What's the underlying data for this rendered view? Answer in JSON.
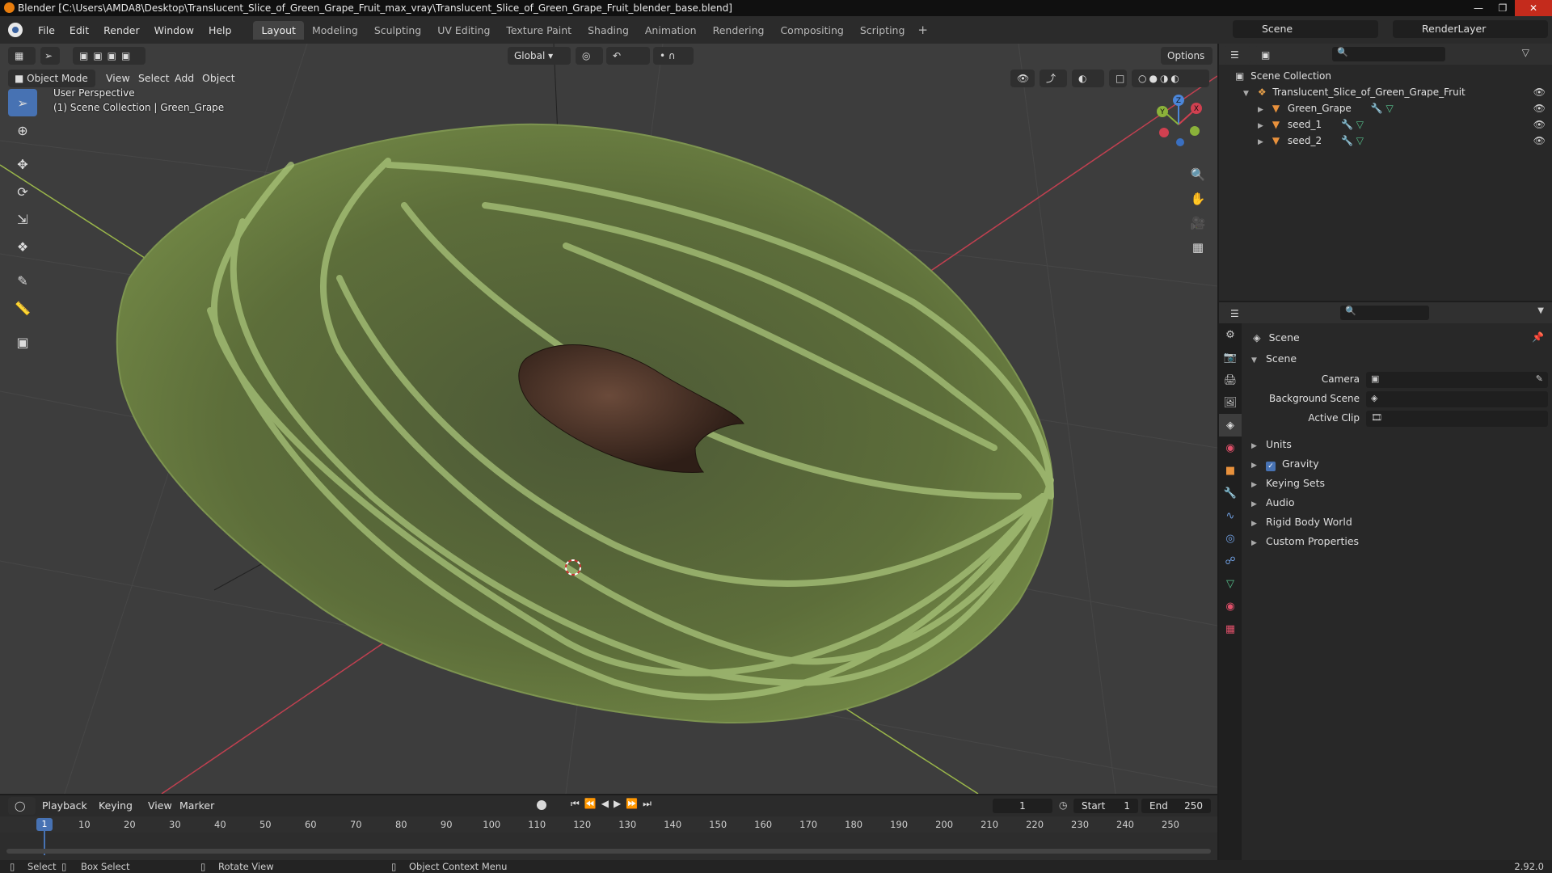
{
  "window": {
    "title": "Blender [C:\\Users\\AMDA8\\Desktop\\Translucent_Slice_of_Green_Grape_Fruit_max_vray\\Translucent_Slice_of_Green_Grape_Fruit_blender_base.blend]"
  },
  "menu": {
    "items": [
      "File",
      "Edit",
      "Render",
      "Window",
      "Help"
    ],
    "workspaces": [
      "Layout",
      "Modeling",
      "Sculpting",
      "UV Editing",
      "Texture Paint",
      "Shading",
      "Animation",
      "Rendering",
      "Compositing",
      "Scripting"
    ],
    "active_workspace": "Layout",
    "scene": "Scene",
    "render_layer": "RenderLayer"
  },
  "viewport": {
    "mode": "Object Mode",
    "menus": [
      "View",
      "Select",
      "Add",
      "Object"
    ],
    "orientation": "Global",
    "options": "Options",
    "perspective": "User Perspective",
    "collection_info": "(1) Scene Collection | Green_Grape"
  },
  "outliner": {
    "root": "Scene Collection",
    "collection": "Translucent_Slice_of_Green_Grape_Fruit",
    "objects": [
      "Green_Grape",
      "seed_1",
      "seed_2"
    ]
  },
  "properties": {
    "context": "Scene",
    "panel": "Scene",
    "fields": {
      "camera": "Camera",
      "background_scene": "Background Scene",
      "active_clip": "Active Clip"
    },
    "subpanels": [
      "Units",
      "Gravity",
      "Keying Sets",
      "Audio",
      "Rigid Body World",
      "Custom Properties"
    ],
    "gravity_enabled": true
  },
  "timeline": {
    "menus": [
      "Playback",
      "Keying",
      "View",
      "Marker"
    ],
    "current_frame": "1",
    "start_label": "Start",
    "start": "1",
    "end_label": "End",
    "end": "250",
    "ruler": [
      "1",
      "10",
      "20",
      "30",
      "40",
      "50",
      "60",
      "70",
      "80",
      "90",
      "100",
      "110",
      "120",
      "130",
      "140",
      "150",
      "160",
      "170",
      "180",
      "190",
      "200",
      "210",
      "220",
      "230",
      "240",
      "250"
    ]
  },
  "statusbar": {
    "select": "Select",
    "box_select": "Box Select",
    "rotate": "Rotate View",
    "context_menu": "Object Context Menu",
    "version": "2.92.0"
  },
  "colors": {
    "accent": "#4772b3",
    "viewport_bg": "#3d3d3d",
    "grape_green": "#8fa860",
    "axis_red": "#c04050",
    "axis_green": "#9ab64a"
  }
}
